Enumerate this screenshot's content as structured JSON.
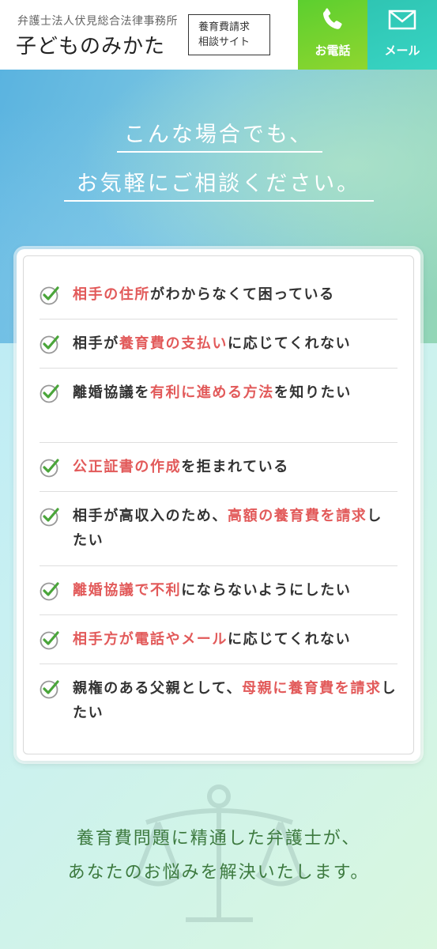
{
  "header": {
    "firm_name": "弁護士法人伏見総合法律事務所",
    "site_title": "子どものみかた",
    "badge_line1": "養育費請求",
    "badge_line2": "相談サイト",
    "tel_label": "お電話",
    "mail_label": "メール",
    "tel_icon": "phone-icon",
    "mail_icon": "mail-icon",
    "colors": {
      "tel": "#5ccf2f",
      "mail": "#2fc5b3"
    }
  },
  "hero": {
    "line1": "こんな場合でも、",
    "line2": "お気軽にご相談ください。"
  },
  "cases": [
    {
      "parts": [
        {
          "t": "相手の住所",
          "hl": true
        },
        {
          "t": "がわからなくて困っている",
          "hl": false
        }
      ]
    },
    {
      "parts": [
        {
          "t": "相手が",
          "hl": false
        },
        {
          "t": "養育費の支払い",
          "hl": true
        },
        {
          "t": "に応じてくれない",
          "hl": false
        }
      ]
    },
    {
      "parts": [
        {
          "t": "離婚協議を",
          "hl": false
        },
        {
          "t": "有利に進める方法",
          "hl": true
        },
        {
          "t": "を知りたい",
          "hl": false
        }
      ]
    },
    {
      "parts": [
        {
          "t": "公正証書の作成",
          "hl": true
        },
        {
          "t": "を拒まれている",
          "hl": false
        }
      ]
    },
    {
      "parts": [
        {
          "t": "相手が高収入のため、",
          "hl": false
        },
        {
          "t": "高額の養育費を請求",
          "hl": true
        },
        {
          "t": "したい",
          "hl": false
        }
      ]
    },
    {
      "parts": [
        {
          "t": "離婚協議で不利",
          "hl": true
        },
        {
          "t": "にならないようにしたい",
          "hl": false
        }
      ]
    },
    {
      "parts": [
        {
          "t": "相手方が電話やメール",
          "hl": true
        },
        {
          "t": "に応じてくれない",
          "hl": false
        }
      ]
    },
    {
      "parts": [
        {
          "t": "親権のある父親として、",
          "hl": false
        },
        {
          "t": "母親に養育費を請求",
          "hl": true
        },
        {
          "t": "したい",
          "hl": false
        }
      ]
    }
  ],
  "check_icon": "check-circle-icon",
  "highlight_color": "#e25a5a",
  "bottom": {
    "line1": "養育費問題に精通した弁護士が、",
    "line2": "あなたのお悩みを解決いたします。",
    "icon": "scales-icon"
  }
}
